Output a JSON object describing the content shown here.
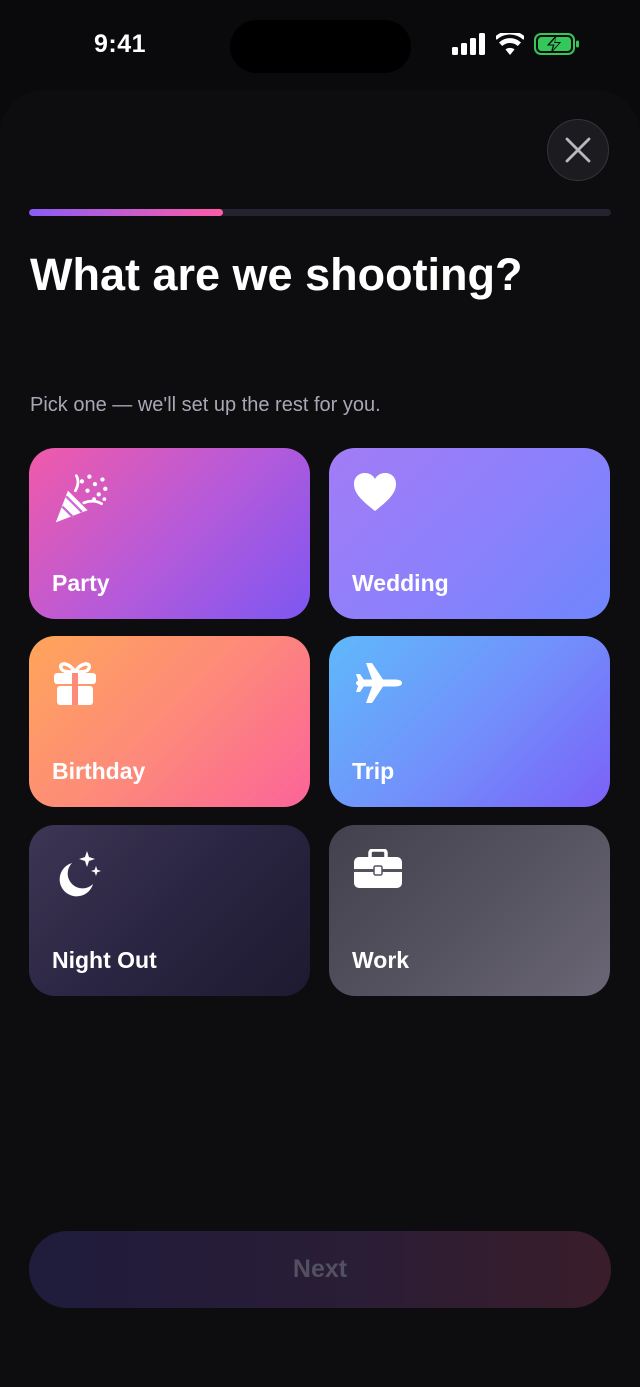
{
  "status_bar": {
    "time": "9:41"
  },
  "progress": {
    "fraction": 0.333
  },
  "header": {
    "title": "What are we shooting?",
    "subtitle": "Pick one — we'll set up the rest for you."
  },
  "categories": [
    {
      "label": "Party",
      "icon": "party-popper-icon"
    },
    {
      "label": "Wedding",
      "icon": "heart-icon"
    },
    {
      "label": "Birthday",
      "icon": "gift-icon"
    },
    {
      "label": "Trip",
      "icon": "airplane-icon"
    },
    {
      "label": "Night Out",
      "icon": "moon-stars-icon"
    },
    {
      "label": "Work",
      "icon": "briefcase-icon"
    }
  ],
  "footer": {
    "next_label": "Next"
  },
  "colors": {
    "background": "#0a0a0d",
    "progress_start": "#8b5cf6",
    "progress_end": "#ff5ca8",
    "battery": "#34c759"
  }
}
